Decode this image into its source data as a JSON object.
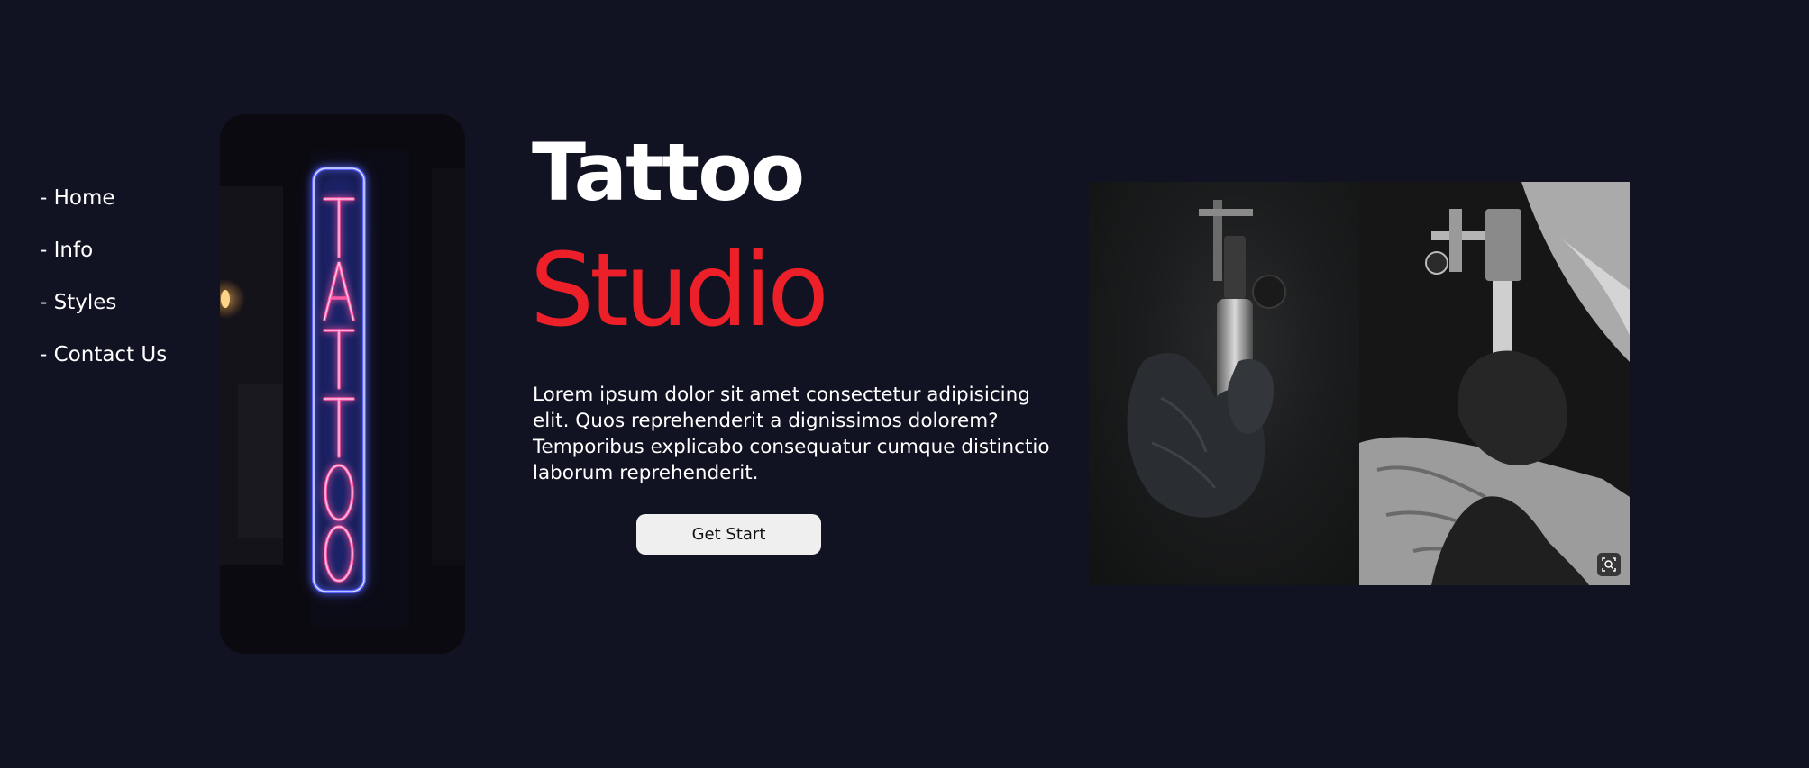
{
  "nav": {
    "items": [
      {
        "label": "- Home"
      },
      {
        "label": "- Info"
      },
      {
        "label": "- Styles"
      },
      {
        "label": "- Contact Us"
      }
    ]
  },
  "neon_sign": {
    "text": "TATTOO",
    "colors": {
      "tube": "#3a4bff",
      "letters": "#ff4fa3"
    }
  },
  "hero": {
    "title_line1": "Tattoo",
    "title_line2": "Studio",
    "description": "Lorem ipsum dolor sit amet consectetur adipisicing elit. Quos reprehenderit a dignissimos dolorem? Temporibus explicabo consequatur cumque distinctio laborum reprehenderit.",
    "cta_label": "Get Start"
  },
  "gallery": {
    "zoom_icon": "zoom-icon"
  },
  "colors": {
    "background": "#111322",
    "accent": "#ed1f28",
    "button_bg": "#efeff0"
  }
}
